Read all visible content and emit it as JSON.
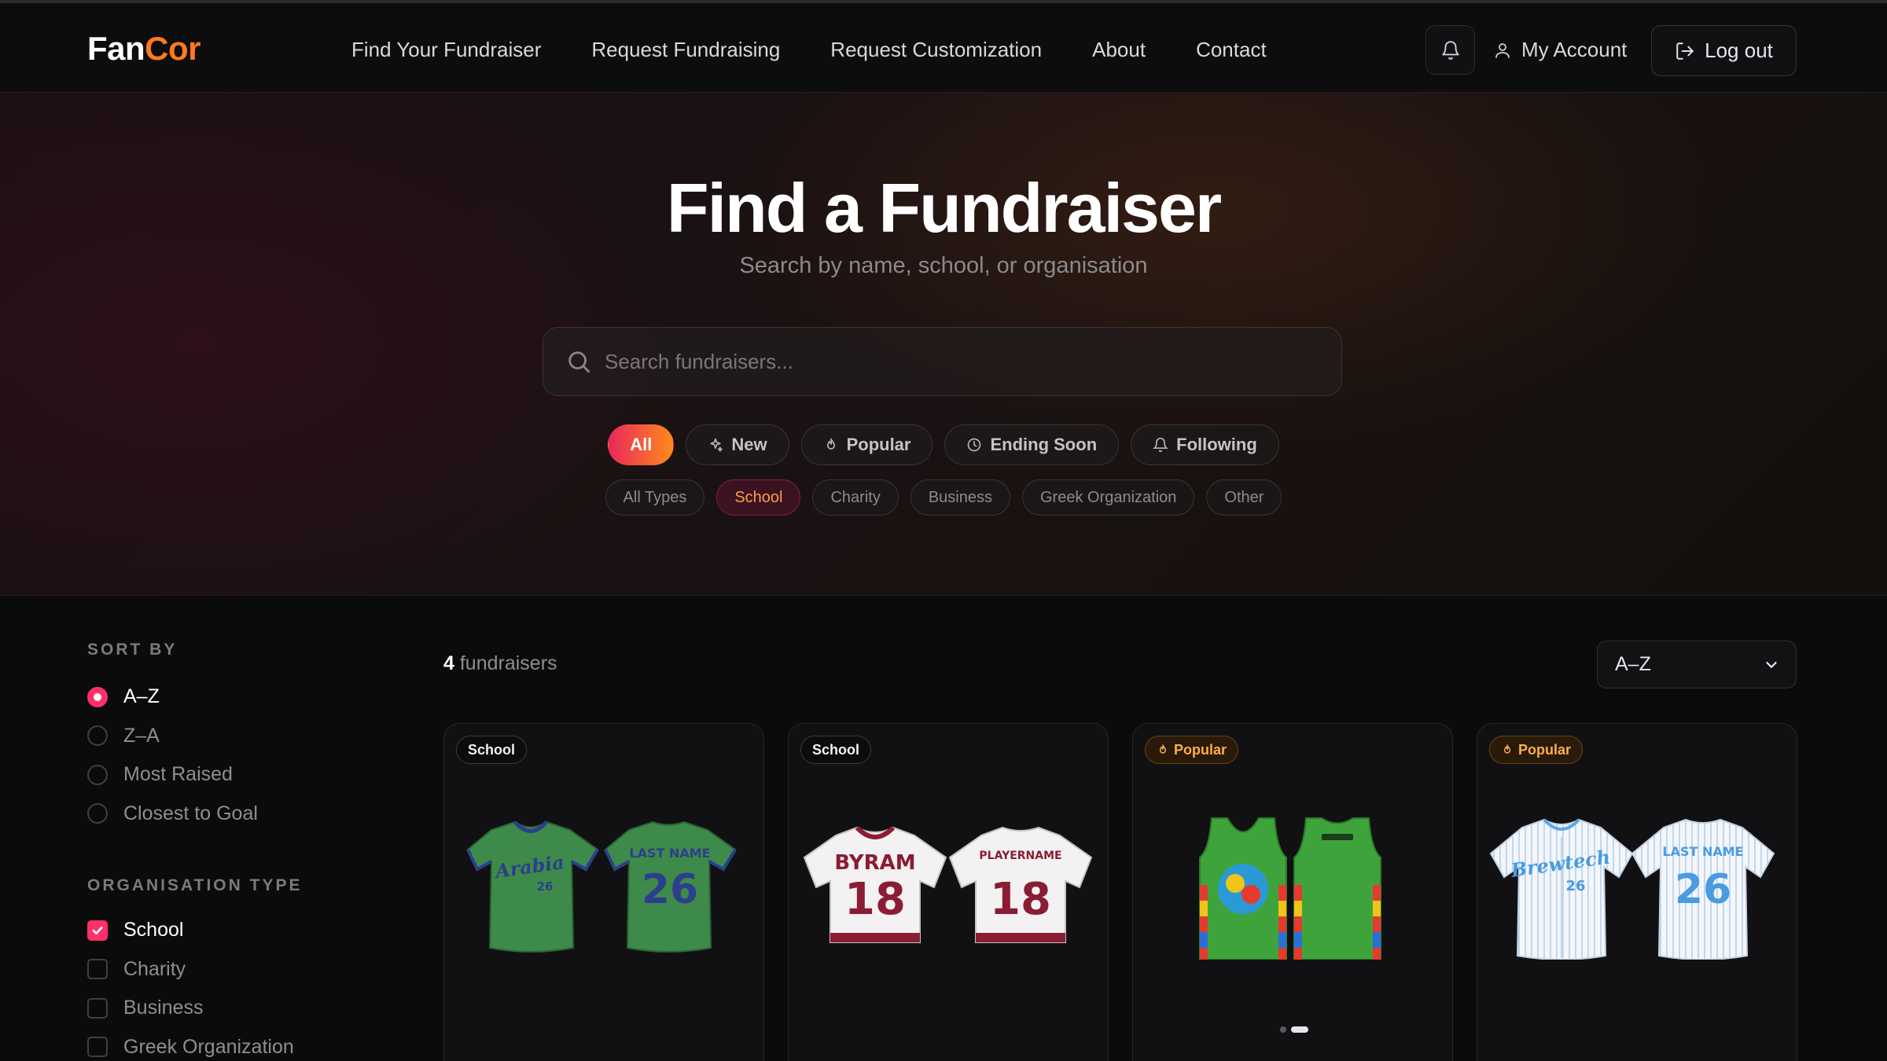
{
  "header": {
    "logo_part1": "Fan",
    "logo_part2": "Cor",
    "nav": [
      "Find Your Fundraiser",
      "Request Fundraising",
      "Request Customization",
      "About",
      "Contact"
    ],
    "account_label": "My Account",
    "logout_label": "Log out"
  },
  "hero": {
    "title": "Find a Fundraiser",
    "subtitle": "Search by name, school, or organisation",
    "search_placeholder": "Search fundraisers...",
    "filters": [
      {
        "label": "All",
        "icon": "none",
        "active": true
      },
      {
        "label": "New",
        "icon": "sparkle-icon"
      },
      {
        "label": "Popular",
        "icon": "flame-icon"
      },
      {
        "label": "Ending Soon",
        "icon": "clock-icon"
      },
      {
        "label": "Following",
        "icon": "bell-icon"
      }
    ],
    "types": [
      {
        "label": "All Types"
      },
      {
        "label": "School",
        "active": true
      },
      {
        "label": "Charity"
      },
      {
        "label": "Business"
      },
      {
        "label": "Greek Organization"
      },
      {
        "label": "Other"
      }
    ]
  },
  "sidebar": {
    "sort_heading": "SORT BY",
    "sort_options": [
      "A–Z",
      "Z–A",
      "Most Raised",
      "Closest to Goal"
    ],
    "sort_selected": "A–Z",
    "org_heading": "ORGANISATION TYPE",
    "org_options": [
      "School",
      "Charity",
      "Business",
      "Greek Organization"
    ],
    "org_checked": [
      "School"
    ]
  },
  "results": {
    "count": "4",
    "count_label": "fundraisers",
    "sort_value": "A–Z",
    "cards": [
      {
        "badge": "School",
        "badge_type": "type",
        "jersey_text_front": "Arabia",
        "jersey_text_back": "LAST NAME",
        "number": "26"
      },
      {
        "badge": "School",
        "badge_type": "type",
        "jersey_text_front": "BYRAM",
        "jersey_text_back": "PLAYERNAME",
        "number": "18"
      },
      {
        "badge": "Popular",
        "badge_type": "popular",
        "jersey_text_front": "",
        "jersey_text_back": "",
        "number": ""
      },
      {
        "badge": "Popular",
        "badge_type": "popular",
        "jersey_text_front": "Brewtech",
        "jersey_text_back": "LAST NAME",
        "number": "26"
      }
    ]
  },
  "colors": {
    "accent_pink": "#ff2f6a",
    "accent_orange": "#ff7a1a",
    "background": "#0b0b0c"
  }
}
